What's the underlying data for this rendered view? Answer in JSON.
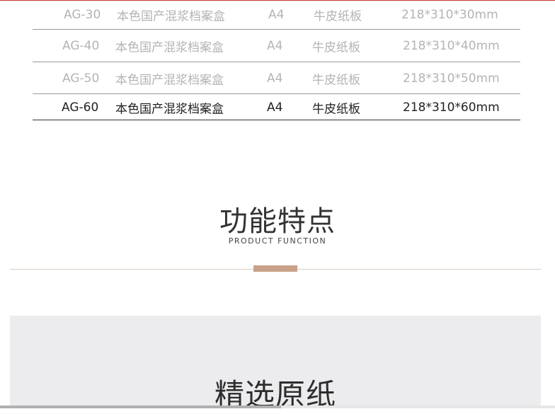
{
  "spec_table": {
    "rows": [
      {
        "model": "AG-30",
        "name": "本色国产混浆档案盒",
        "size": "A4",
        "material": "牛皮纸板",
        "dimensions": "218*310*30mm",
        "state": "dim"
      },
      {
        "model": "AG-40",
        "name": "本色国产混浆档案盒",
        "size": "A4",
        "material": "牛皮纸板",
        "dimensions": "218*310*40mm",
        "state": "dim"
      },
      {
        "model": "AG-50",
        "name": "本色国产混浆档案盒",
        "size": "A4",
        "material": "牛皮纸板",
        "dimensions": "218*310*50mm",
        "state": "dim"
      },
      {
        "model": "AG-60",
        "name": "本色国产混浆档案盒",
        "size": "A4",
        "material": "牛皮纸板",
        "dimensions": "218*310*60mm",
        "state": "active"
      }
    ]
  },
  "features_section": {
    "title_cn": "功能特点",
    "title_en": "PRODUCT FUNCTION"
  },
  "paper_section": {
    "title": "精选原纸"
  },
  "colors": {
    "accent": "#c9a08a",
    "top_rule": "#c9302c",
    "panel_bg": "#ecebee"
  }
}
